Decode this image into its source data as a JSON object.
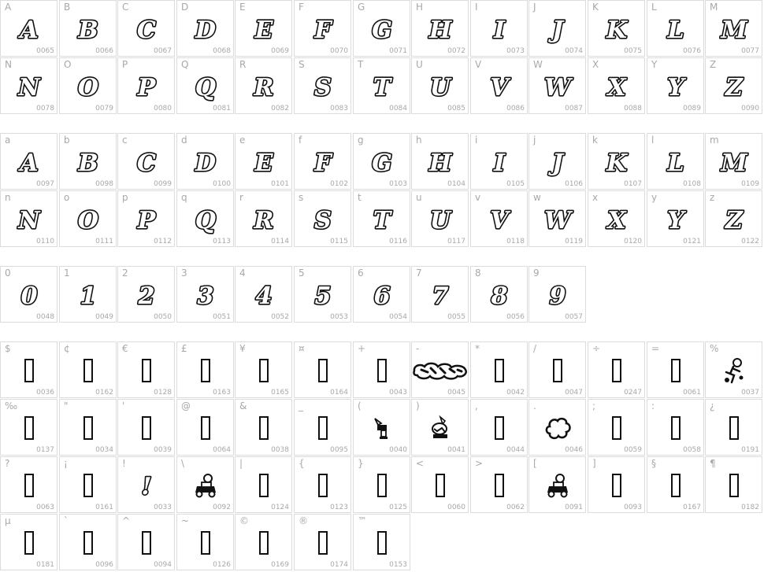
{
  "sections": [
    {
      "rows": [
        [
          [
            "A",
            "0065",
            "A"
          ],
          [
            "B",
            "0066",
            "B"
          ],
          [
            "C",
            "0067",
            "C"
          ],
          [
            "D",
            "0068",
            "D"
          ],
          [
            "E",
            "0069",
            "E"
          ],
          [
            "F",
            "0070",
            "F"
          ],
          [
            "G",
            "0071",
            "G"
          ],
          [
            "H",
            "0072",
            "H"
          ],
          [
            "I",
            "0073",
            "I"
          ],
          [
            "J",
            "0074",
            "J"
          ],
          [
            "K",
            "0075",
            "K"
          ],
          [
            "L",
            "0076",
            "L"
          ],
          [
            "M",
            "0077",
            "M"
          ]
        ],
        [
          [
            "N",
            "0078",
            "N"
          ],
          [
            "O",
            "0079",
            "O"
          ],
          [
            "P",
            "0080",
            "P"
          ],
          [
            "Q",
            "0081",
            "Q"
          ],
          [
            "R",
            "0082",
            "R"
          ],
          [
            "S",
            "0083",
            "S"
          ],
          [
            "T",
            "0084",
            "T"
          ],
          [
            "U",
            "0085",
            "U"
          ],
          [
            "V",
            "0086",
            "V"
          ],
          [
            "W",
            "0087",
            "W"
          ],
          [
            "X",
            "0088",
            "X"
          ],
          [
            "Y",
            "0089",
            "Y"
          ],
          [
            "Z",
            "0090",
            "Z"
          ]
        ]
      ]
    },
    {
      "rows": [
        [
          [
            "a",
            "0097",
            "A"
          ],
          [
            "b",
            "0098",
            "B"
          ],
          [
            "c",
            "0099",
            "C"
          ],
          [
            "d",
            "0100",
            "D"
          ],
          [
            "e",
            "0101",
            "E"
          ],
          [
            "f",
            "0102",
            "F"
          ],
          [
            "g",
            "0103",
            "G"
          ],
          [
            "h",
            "0104",
            "H"
          ],
          [
            "i",
            "0105",
            "I"
          ],
          [
            "j",
            "0106",
            "J"
          ],
          [
            "k",
            "0107",
            "K"
          ],
          [
            "l",
            "0108",
            "L"
          ],
          [
            "m",
            "0109",
            "M"
          ]
        ],
        [
          [
            "n",
            "0110",
            "N"
          ],
          [
            "o",
            "0111",
            "O"
          ],
          [
            "p",
            "0112",
            "P"
          ],
          [
            "q",
            "0113",
            "Q"
          ],
          [
            "r",
            "0114",
            "R"
          ],
          [
            "s",
            "0115",
            "S"
          ],
          [
            "t",
            "0116",
            "T"
          ],
          [
            "u",
            "0117",
            "U"
          ],
          [
            "v",
            "0118",
            "V"
          ],
          [
            "w",
            "0119",
            "W"
          ],
          [
            "x",
            "0120",
            "X"
          ],
          [
            "y",
            "0121",
            "Y"
          ],
          [
            "z",
            "0122",
            "Z"
          ]
        ]
      ]
    },
    {
      "rows": [
        [
          [
            "0",
            "0048",
            "0"
          ],
          [
            "1",
            "0049",
            "1"
          ],
          [
            "2",
            "0050",
            "2"
          ],
          [
            "3",
            "0051",
            "3"
          ],
          [
            "4",
            "0052",
            "4"
          ],
          [
            "5",
            "0053",
            "5"
          ],
          [
            "6",
            "0054",
            "6"
          ],
          [
            "7",
            "0055",
            "7"
          ],
          [
            "8",
            "0056",
            "8"
          ],
          [
            "9",
            "0057",
            "9"
          ]
        ]
      ]
    },
    {
      "rows": [
        [
          [
            "$",
            "0036",
            ""
          ],
          [
            "¢",
            "0162",
            ""
          ],
          [
            "€",
            "0128",
            ""
          ],
          [
            "£",
            "0163",
            ""
          ],
          [
            "¥",
            "0165",
            ""
          ],
          [
            "¤",
            "0164",
            ""
          ],
          [
            "+",
            "0043",
            ""
          ],
          [
            "-",
            "0045",
            "#splash"
          ],
          [
            "*",
            "0042",
            ""
          ],
          [
            "/",
            "0047",
            ""
          ],
          [
            "÷",
            "0247",
            ""
          ],
          [
            "=",
            "0061",
            ""
          ],
          [
            "%",
            "0037",
            "#figure-small"
          ]
        ],
        [
          [
            "‰",
            "0137",
            ""
          ],
          [
            "\"",
            "0034",
            ""
          ],
          [
            "'",
            "0039",
            ""
          ],
          [
            "@",
            "0064",
            ""
          ],
          [
            "&",
            "0038",
            ""
          ],
          [
            "_",
            "0095",
            ""
          ],
          [
            "(",
            "0040",
            "#figure-gun"
          ],
          [
            ")",
            "0041",
            "#figure-dog"
          ],
          [
            ",",
            "0044",
            ""
          ],
          [
            ".",
            "0046",
            "#cloud"
          ],
          [
            ";",
            "0059",
            ""
          ],
          [
            ":",
            "0058",
            ""
          ],
          [
            "¿",
            "0191",
            ""
          ]
        ],
        [
          [
            "?",
            "0063",
            ""
          ],
          [
            "¡",
            "0161",
            ""
          ],
          [
            "!",
            "0033",
            "!"
          ],
          [
            "\\",
            "0092",
            "#figure-car"
          ],
          [
            "|",
            "0124",
            ""
          ],
          [
            "{",
            "0123",
            ""
          ],
          [
            "}",
            "0125",
            ""
          ],
          [
            "<",
            "0060",
            ""
          ],
          [
            ">",
            "0062",
            ""
          ],
          [
            "[",
            "0091",
            "#figure-car"
          ],
          [
            "]",
            "0093",
            ""
          ],
          [
            "§",
            "0167",
            ""
          ],
          [
            "¶",
            "0182",
            ""
          ]
        ],
        [
          [
            "µ",
            "0181",
            ""
          ],
          [
            "`",
            "0096",
            ""
          ],
          [
            "^",
            "0094",
            ""
          ],
          [
            "~",
            "0126",
            ""
          ],
          [
            "©",
            "0169",
            ""
          ],
          [
            "®",
            "0174",
            ""
          ],
          [
            "™",
            "0153",
            ""
          ]
        ]
      ]
    }
  ]
}
